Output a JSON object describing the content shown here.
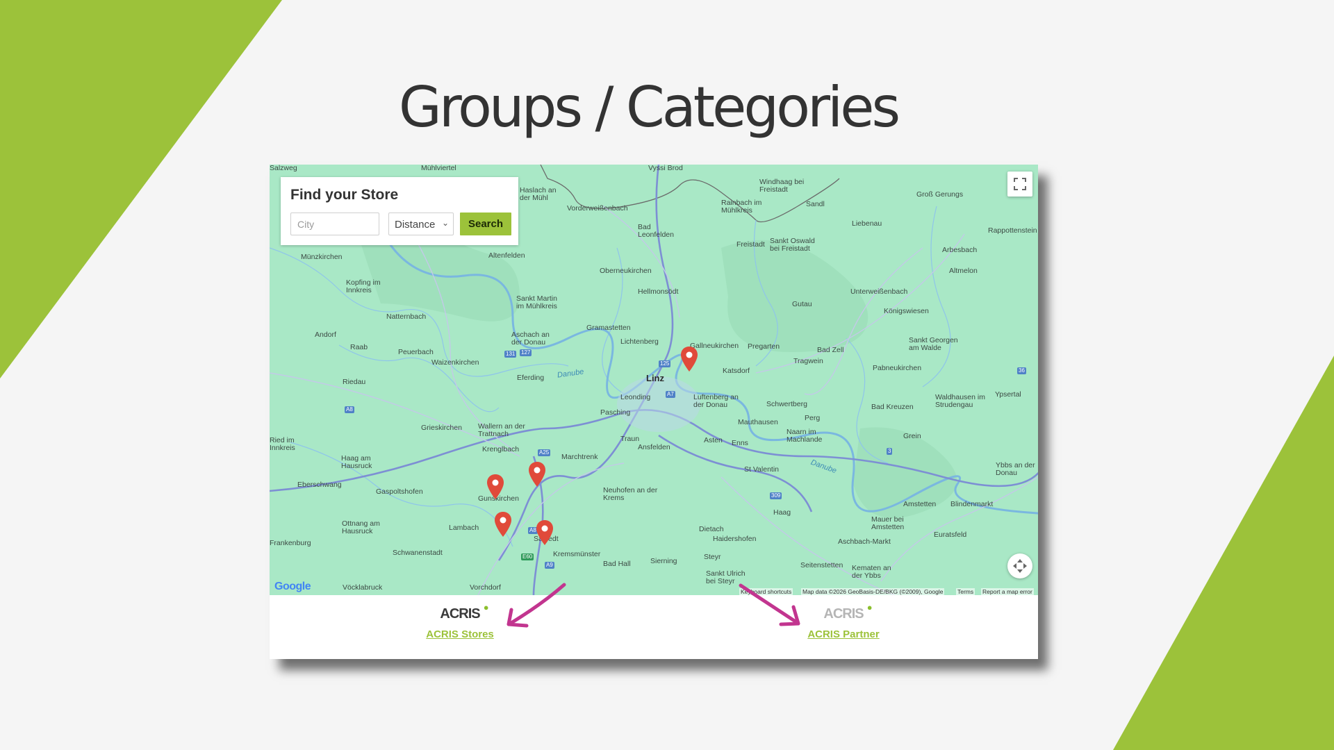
{
  "slide": {
    "title": "Groups / Categories",
    "colors": {
      "accent": "#9cc23a",
      "background": "#f5f5f5",
      "arrow": "#c2358f",
      "marker": "#e04a3a"
    }
  },
  "store_search": {
    "title": "Find your Store",
    "city_placeholder": "City",
    "distance_selected": "Distance",
    "search_label": "Search"
  },
  "map": {
    "controls": {
      "fullscreen_icon": "fullscreen-icon",
      "camera_icon": "camera-control-icon"
    },
    "google_logo": "Google",
    "attribution": {
      "keyboard": "Keyboard shortcuts",
      "data": "Map data ©2026 GeoBasis-DE/BKG (©2009), Google",
      "terms": "Terms",
      "report": "Report a map error"
    },
    "places": [
      "Salzweg",
      "Mühlviertel",
      "Vyssi Brod",
      "Windhaag bei Freistadt",
      "Sandl",
      "Groß Gerungs",
      "Haslach an der Mühl",
      "Vorderweißenbach",
      "Rainbach im Mühlkreis",
      "Liebenau",
      "Rappottenstein",
      "Bad Leonfelden",
      "Sankt Oswald bei Freistadt",
      "Freistadt",
      "Arbesbach",
      "Altmelon",
      "Münzkirchen",
      "Altenfelden",
      "Oberneukirchen",
      "Kopfing im Innkreis",
      "Sankt Martin im Mühlkreis",
      "Hellmonsödt",
      "Gutau",
      "Unterweißenbach",
      "Natternbach",
      "Gramastetten",
      "Königswiesen",
      "Andorf",
      "Aschach an der Donau",
      "Lichtenberg",
      "Gallneukirchen",
      "Pregarten",
      "Bad Zell",
      "Sankt Georgen am Walde",
      "Raab",
      "Peuerbach",
      "Waizenkirchen",
      "Eferding",
      "Katsdorf",
      "Tragwein",
      "Pabneukirchen",
      "Riedau",
      "Linz",
      "Leonding",
      "Luftenberg an der Donau",
      "Schwertberg",
      "Bad Kreuzen",
      "Waldhausen im Strudengau",
      "Ypsertal",
      "Pasching",
      "Mauthausen",
      "Perg",
      "Naarn im Machlande",
      "Grein",
      "Grieskirchen",
      "Wallern an der Trattnach",
      "Traun",
      "Ansfelden",
      "Asten",
      "Enns",
      "Ried im Innkreis",
      "Krenglbach",
      "Marchtrenk",
      "Haag am Hausruck",
      "St Valentin",
      "Ybbs an der Donau",
      "Eberschwang",
      "Gunskirchen",
      "Gaspoltshofen",
      "Neuhofen an der Krems",
      "Amstetten",
      "Blindenmarkt",
      "Ottnang am Hausruck",
      "Lambach",
      "Sattledt",
      "Haag",
      "Mauer bei Amstetten",
      "Euratsfeld",
      "Dietach",
      "Haidershofen",
      "Aschbach-Markt",
      "Frankenburg",
      "Schwanenstadt",
      "Kremsmünster",
      "Bad Hall",
      "Sierning",
      "Steyr",
      "Seitenstetten",
      "Kematen an der Ybbs",
      "Sankt Ulrich bei Steyr",
      "Vöcklabruck",
      "Vorchdorf",
      "Danube"
    ]
  },
  "groups": [
    {
      "logo": "ACRIS",
      "link": "ACRIS Stores"
    },
    {
      "logo": "ACRIS",
      "link": "ACRIS Partner"
    }
  ]
}
